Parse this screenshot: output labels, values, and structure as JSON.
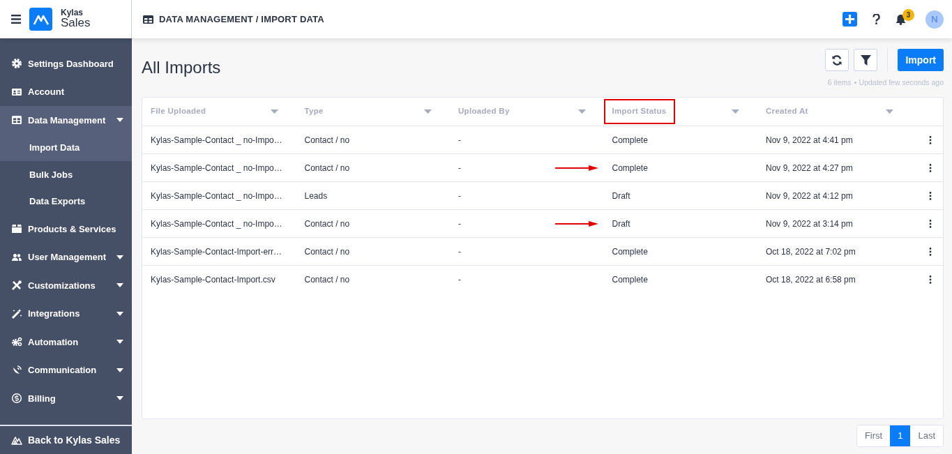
{
  "app": {
    "brand_top": "Kylas",
    "brand_bottom": "Sales"
  },
  "breadcrumb": "DATA MANAGEMENT / IMPORT DATA",
  "header": {
    "notification_count": "3",
    "avatar": "N"
  },
  "sidebar": {
    "items": [
      {
        "label": "Settings Dashboard",
        "selected": false,
        "has_caret": false
      },
      {
        "label": "Account",
        "selected": false,
        "has_caret": false
      },
      {
        "label": "Data Management",
        "selected": false,
        "has_caret": true,
        "expanded": true,
        "children": [
          {
            "label": "Import Data",
            "selected": true
          },
          {
            "label": "Bulk Jobs",
            "selected": false
          },
          {
            "label": "Data Exports",
            "selected": false
          }
        ]
      },
      {
        "label": "Products & Services",
        "selected": false,
        "has_caret": false
      },
      {
        "label": "User Management",
        "selected": false,
        "has_caret": true,
        "expanded": false
      },
      {
        "label": "Customizations",
        "selected": false,
        "has_caret": true,
        "expanded": false
      },
      {
        "label": "Integrations",
        "selected": false,
        "has_caret": true,
        "expanded": false
      },
      {
        "label": "Automation",
        "selected": false,
        "has_caret": true,
        "expanded": false
      },
      {
        "label": "Communication",
        "selected": false,
        "has_caret": true,
        "expanded": false
      },
      {
        "label": "Billing",
        "selected": false,
        "has_caret": true,
        "expanded": false
      }
    ],
    "back_link": "Back to Kylas Sales"
  },
  "page": {
    "title": "All Imports",
    "import_button": "Import",
    "items_count": "6 items",
    "updated": "Updated few seconds ago"
  },
  "table": {
    "columns": [
      {
        "label": "File Uploaded",
        "highlighted": false
      },
      {
        "label": "Type",
        "highlighted": false
      },
      {
        "label": "Uploaded By",
        "highlighted": false
      },
      {
        "label": "Import Status",
        "highlighted": true
      },
      {
        "label": "Created At",
        "highlighted": false
      }
    ],
    "rows": [
      {
        "cells": [
          "Kylas-Sample-Contact _ no-Impo…",
          "Contact / no",
          "-",
          "Complete",
          "Nov 9, 2022 at 4:41 pm"
        ],
        "arrow": false
      },
      {
        "cells": [
          "Kylas-Sample-Contact _ no-Impo…",
          "Contact / no",
          "-",
          "Complete",
          "Nov 9, 2022 at 4:27 pm"
        ],
        "arrow": true
      },
      {
        "cells": [
          "Kylas-Sample-Contact _ no-Impo…",
          "Leads",
          "-",
          "Draft",
          "Nov 9, 2022 at 4:12 pm"
        ],
        "arrow": false
      },
      {
        "cells": [
          "Kylas-Sample-Contact _ no-Impo…",
          "Contact / no",
          "-",
          "Draft",
          "Nov 9, 2022 at 3:14 pm"
        ],
        "arrow": true
      },
      {
        "cells": [
          "Kylas-Sample-Contact-Import-err…",
          "Contact / no",
          "-",
          "Complete",
          "Oct 18, 2022 at 7:02 pm"
        ],
        "arrow": false
      },
      {
        "cells": [
          "Kylas-Sample-Contact-Import.csv",
          "Contact / no",
          "-",
          "Complete",
          "Oct 18, 2022 at 6:58 pm"
        ],
        "arrow": false
      }
    ]
  },
  "pagination": [
    {
      "label": "First",
      "selected": false
    },
    {
      "label": "1",
      "selected": true
    },
    {
      "label": "Last",
      "selected": false
    }
  ]
}
